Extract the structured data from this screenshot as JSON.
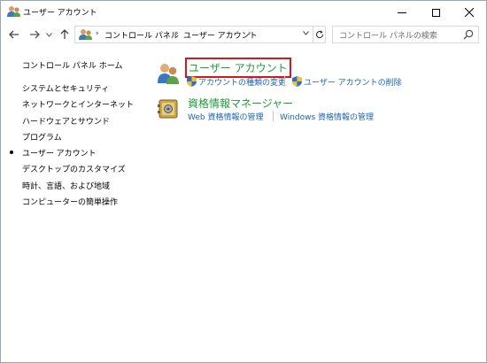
{
  "window": {
    "title": "ユーザー アカウント"
  },
  "address": {
    "breadcrumbs": [
      "コントロール パネル",
      "ユーザー アカウント"
    ],
    "search_placeholder": "コントロール パネルの検索"
  },
  "sidebar": {
    "items": [
      "コントロール パネル ホーム",
      "システムとセキュリティ",
      "ネットワークとインターネット",
      "ハードウェアとサウンド",
      "プログラム",
      "ユーザー アカウント",
      "デスクトップのカスタマイズ",
      "時計、言語、および地域",
      "コンピューターの簡単操作"
    ],
    "selected_index": 5
  },
  "categories": [
    {
      "title": "ユーザー アカウント",
      "links": [
        "アカウントの種類の変更",
        "ユーザー アカウントの削除"
      ]
    },
    {
      "title": "資格情報マネージャー",
      "links": [
        "Web 資格情報の管理",
        "Windows 資格情報の管理"
      ]
    }
  ],
  "colors": {
    "category_title": "#1e9a3c",
    "link": "#1a64b4",
    "highlight_box": "#d21a1a"
  },
  "icons": {
    "title": "users-icon",
    "close": "close-icon",
    "shield": "uac-shield-icon"
  }
}
